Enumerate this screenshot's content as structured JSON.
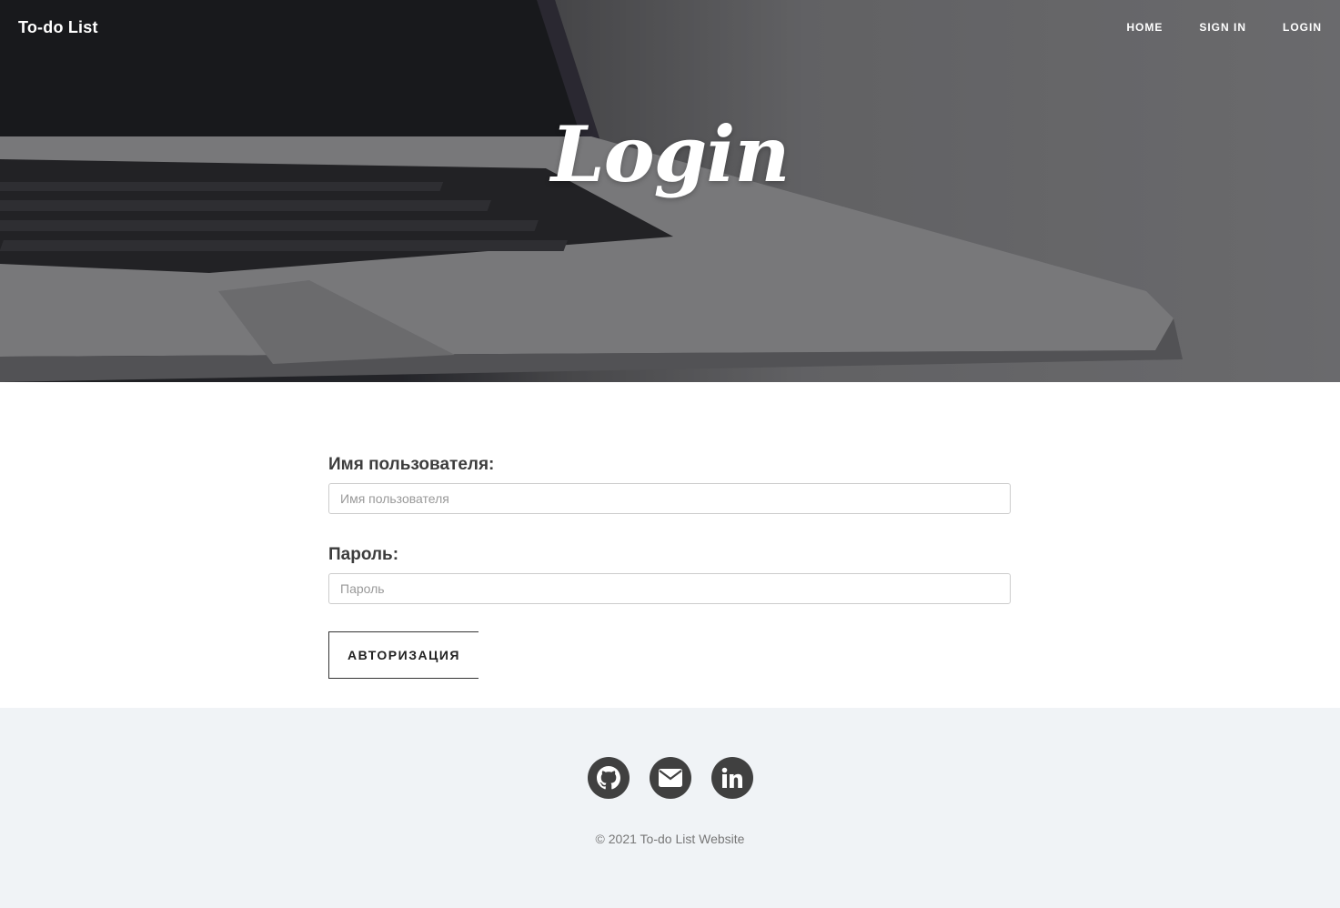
{
  "navbar": {
    "brand": "To-do List",
    "links": [
      "Home",
      "Sign in",
      "Login"
    ]
  },
  "hero": {
    "title": "Login"
  },
  "form": {
    "username_label": "Имя пользователя:",
    "username_placeholder": "Имя пользователя",
    "password_label": "Пароль:",
    "password_placeholder": "Пароль",
    "submit_label": "АВТОРИЗАЦИЯ"
  },
  "footer": {
    "social": [
      "github-icon",
      "envelope-icon",
      "linkedin-icon"
    ],
    "copyright": "© 2021 To-do List Website"
  },
  "colors": {
    "footer_bg": "#f0f3f6",
    "social_bg": "#404040"
  }
}
